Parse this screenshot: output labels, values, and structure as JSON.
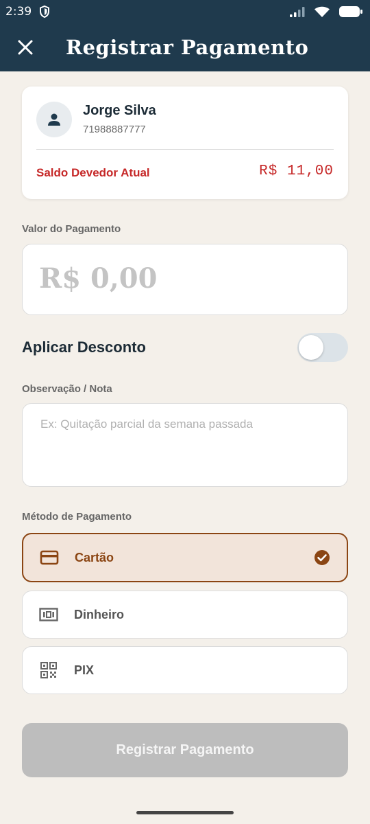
{
  "status_bar": {
    "time": "2:39",
    "icons": [
      "shield-icon",
      "cell-signal-icon",
      "wifi-icon",
      "battery-icon"
    ]
  },
  "app_bar": {
    "title": "Registrar Pagamento",
    "close_icon": "close-icon"
  },
  "client": {
    "name": "Jorge Silva",
    "phone": "71988887777",
    "avatar_icon": "person-icon",
    "balance_label": "Saldo Devedor Atual",
    "balance_value": "R$ 11,00"
  },
  "payment": {
    "amount_label": "Valor do Pagamento",
    "amount_placeholder": "R$ 0,00"
  },
  "discount": {
    "label": "Aplicar Desconto",
    "enabled": false
  },
  "note": {
    "label": "Observação / Nota",
    "placeholder": "Ex: Quitação parcial da semana passada"
  },
  "methods": {
    "label": "Método de Pagamento",
    "items": [
      {
        "label": "Cartão",
        "icon": "credit-card-icon",
        "selected": true
      },
      {
        "label": "Dinheiro",
        "icon": "cash-icon",
        "selected": false
      },
      {
        "label": "PIX",
        "icon": "qr-code-icon",
        "selected": false
      }
    ]
  },
  "submit": {
    "label": "Registrar Pagamento"
  },
  "colors": {
    "primary": "#1f3a4d",
    "background": "#f4f0ea",
    "danger": "#c62828",
    "accent": "#8b4513",
    "selected_bg": "#f2e4da",
    "disabled_button": "#bdbdbd"
  }
}
